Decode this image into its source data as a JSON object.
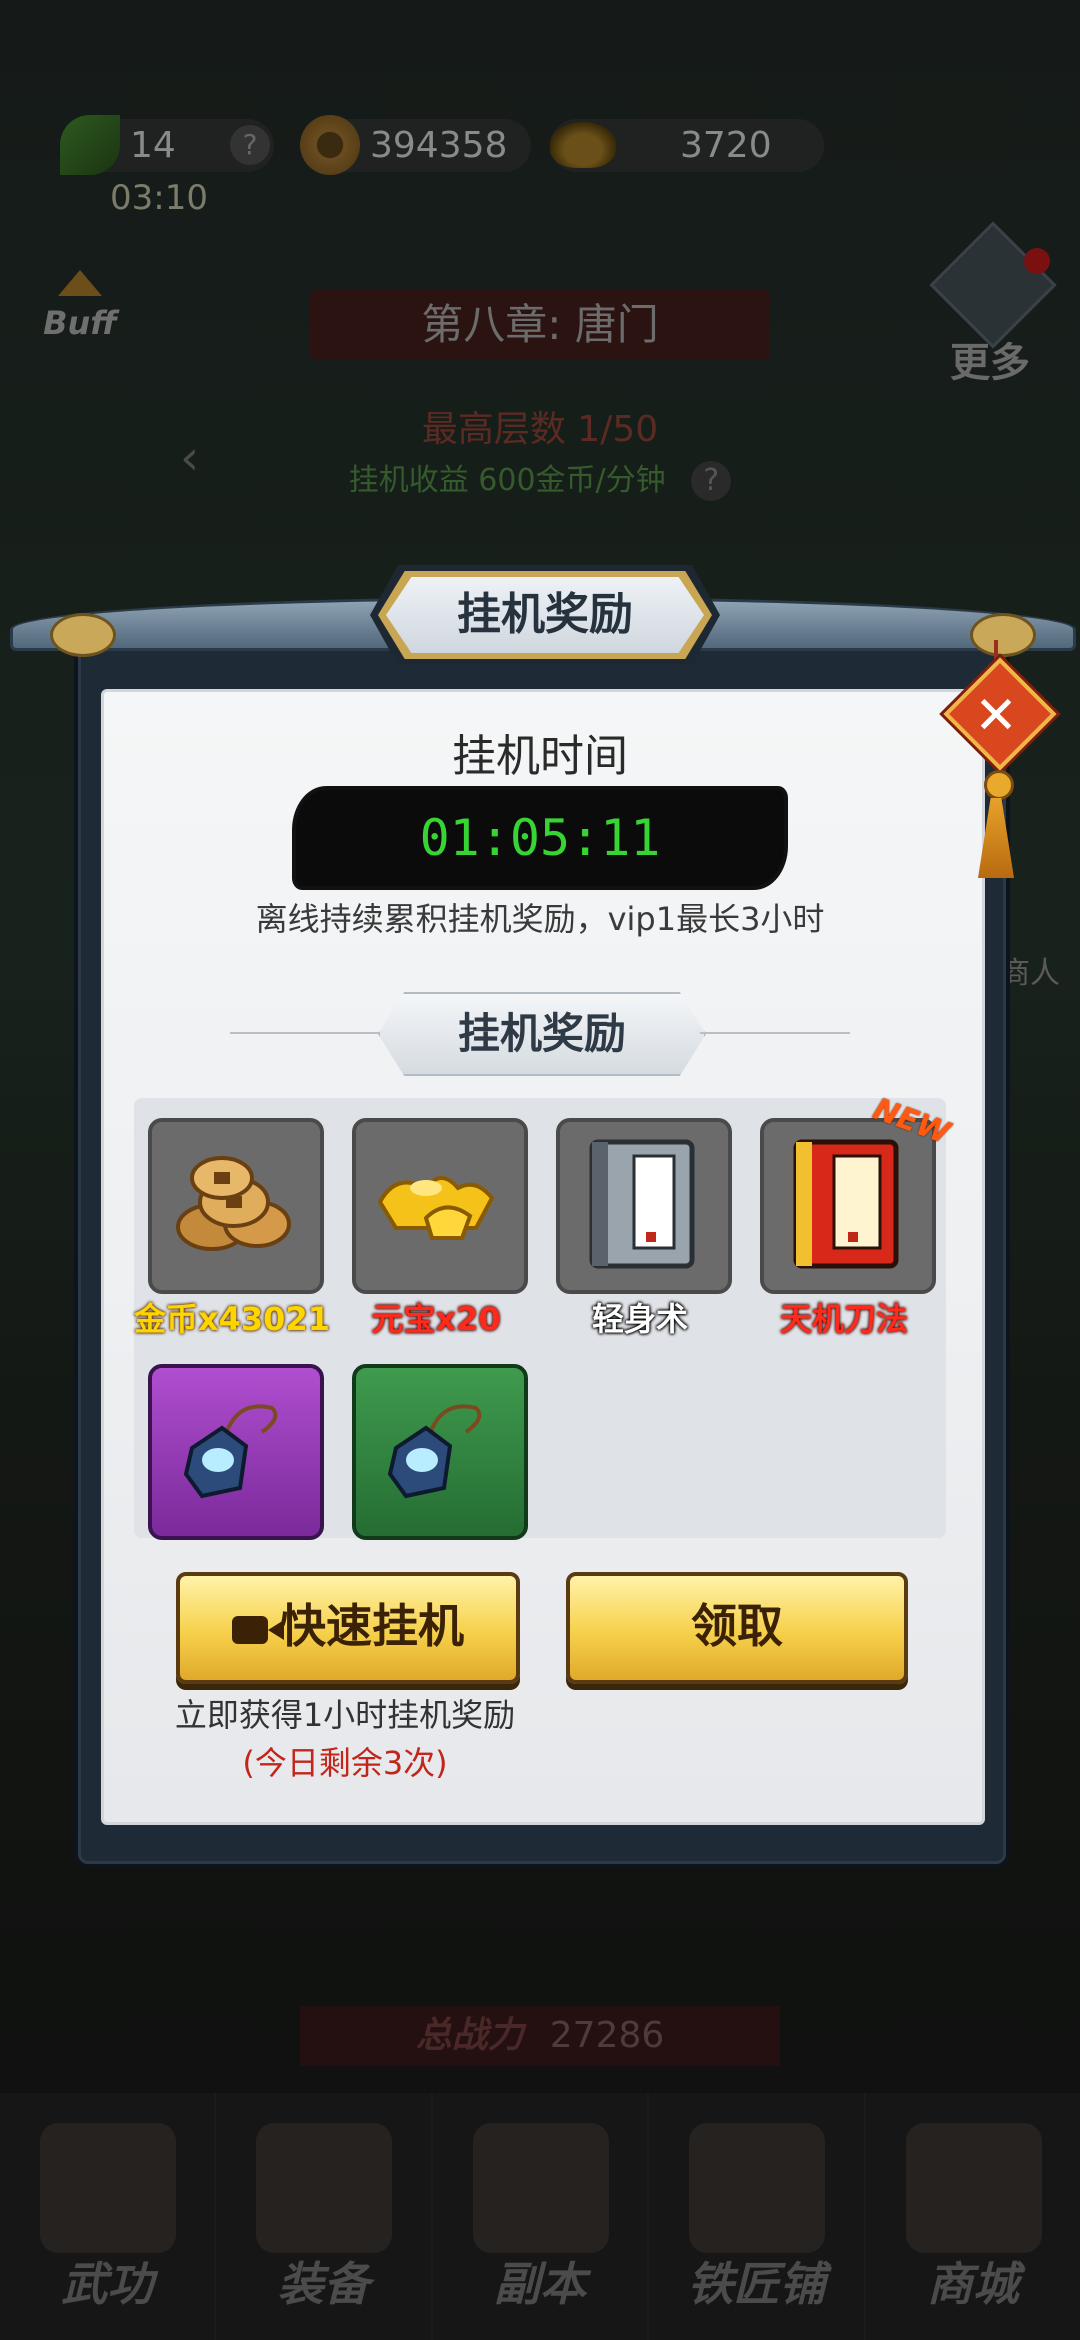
{
  "status": {
    "energy": "14",
    "energy_help": "?",
    "coins": "394358",
    "ingots": "3720",
    "energy_timer": "03:10"
  },
  "background": {
    "buff_label": "Buff",
    "chapter_title": "第八章: 唐门",
    "more_label": "更多",
    "max_floor": "最高层数 1/50",
    "idle_income": "挂机收益 600金币/分钟",
    "income_help": "?",
    "merchant_label": "商人",
    "power_label": "总战力",
    "power_value": "27286"
  },
  "bottom_nav": [
    {
      "label": "武功"
    },
    {
      "label": "装备"
    },
    {
      "label": "副本"
    },
    {
      "label": "铁匠铺"
    },
    {
      "label": "商城"
    }
  ],
  "dialog": {
    "title": "挂机奖励",
    "close_symbol": "✕",
    "idle_time_label": "挂机时间",
    "idle_time_value": "01:05:11",
    "idle_note": "离线持续累积挂机奖励，vip1最长3小时",
    "rewards_header": "挂机奖励",
    "items": [
      {
        "label": "金币x43021",
        "icon": "coins-icon",
        "quality": "grey",
        "label_color": "yellow"
      },
      {
        "label": "元宝x20",
        "icon": "gold-ingot-icon",
        "quality": "grey",
        "label_color": "red"
      },
      {
        "label": "轻身术",
        "icon": "skill-book-icon",
        "quality": "grey",
        "label_color": "white"
      },
      {
        "label": "天机刀法",
        "icon": "skill-book-icon",
        "quality": "grey",
        "label_color": "red",
        "badge": "NEW"
      },
      {
        "label": "",
        "icon": "amulet-icon",
        "quality": "purple"
      },
      {
        "label": "",
        "icon": "amulet-icon",
        "quality": "green"
      }
    ],
    "quick_idle_button": "快速挂机",
    "claim_button": "领取",
    "quick_idle_note": "立即获得1小时挂机奖励",
    "quick_idle_remaining": "(今日剩余3次)"
  }
}
